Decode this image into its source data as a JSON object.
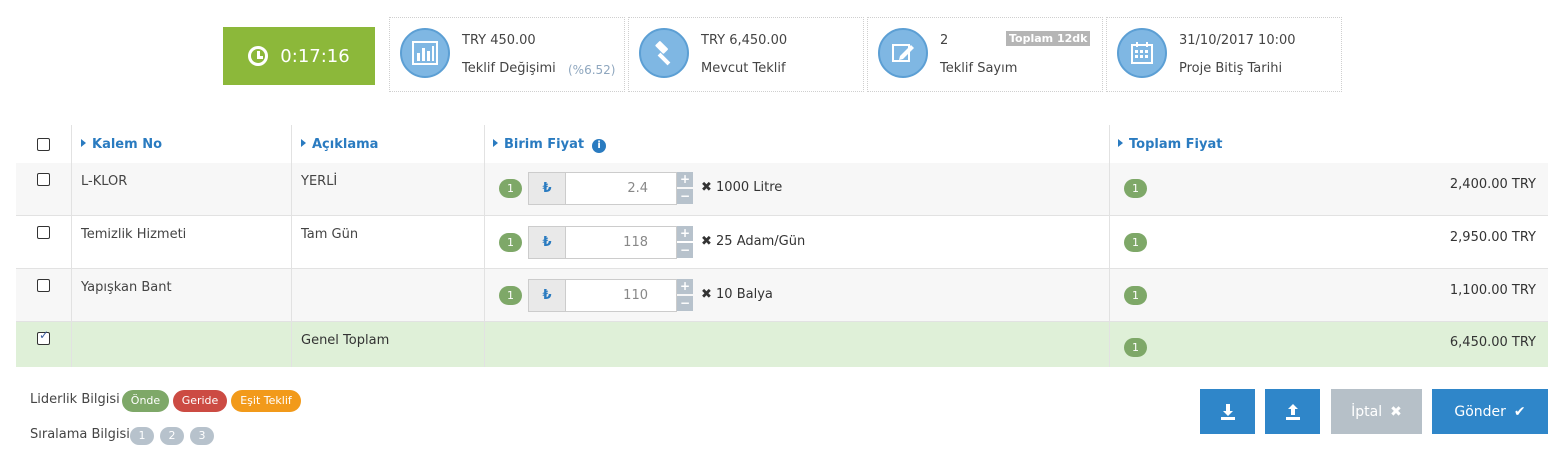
{
  "timer": {
    "value": "0:17:16"
  },
  "stats": [
    {
      "value": "TRY 450.00",
      "label": "Teklif Değişimi",
      "extra": "(%6.52)"
    },
    {
      "value": "TRY 6,450.00",
      "label": "Mevcut Teklif"
    },
    {
      "value": "2",
      "label": "Teklif Sayım",
      "tag": "Toplam 12dk"
    },
    {
      "value": "31/10/2017 10:00",
      "label": "Proje Bitiş Tarihi"
    }
  ],
  "table": {
    "headers": {
      "item_no": "Kalem No",
      "desc": "Açıklama",
      "unit_price": "Birim Fiyat",
      "total_price": "Toplam Fiyat",
      "info": "i"
    },
    "rows": [
      {
        "item": "L-KLOR",
        "desc": "YERLİ",
        "rank": "1",
        "currency": "₺",
        "price": "2.4",
        "qty": "✖ 1000 Litre",
        "total_rank": "1",
        "total": "2,400.00 TRY"
      },
      {
        "item": "Temizlik Hizmeti",
        "desc": "Tam Gün",
        "rank": "1",
        "currency": "₺",
        "price": "118",
        "qty": "✖ 25 Adam/Gün",
        "total_rank": "1",
        "total": "2,950.00 TRY"
      },
      {
        "item": "Yapışkan Bant",
        "desc": "",
        "rank": "1",
        "currency": "₺",
        "price": "110",
        "qty": "✖ 10 Balya",
        "total_rank": "1",
        "total": "1,100.00 TRY"
      }
    ],
    "grand": {
      "label": "Genel Toplam",
      "rank": "1",
      "total": "6,450.00 TRY"
    }
  },
  "legend": {
    "leader_label": "Liderlik Bilgisi",
    "leader_items": [
      {
        "label": "Önde",
        "color": "#7ea868"
      },
      {
        "label": "Geride",
        "color": "#cc4b43"
      },
      {
        "label": "Eşit Teklif",
        "color": "#f29a1a"
      }
    ],
    "rank_label": "Sıralama Bilgisi",
    "ranks": [
      "1",
      "2",
      "3"
    ]
  },
  "buttons": {
    "cancel": "İptal",
    "send": "Gönder",
    "colors": {
      "blue": "#2f86c9",
      "gray": "#b6c0c8"
    }
  },
  "icons": {
    "plus": "+",
    "minus": "−",
    "cancel_x": "✖",
    "send_check": "✔"
  }
}
